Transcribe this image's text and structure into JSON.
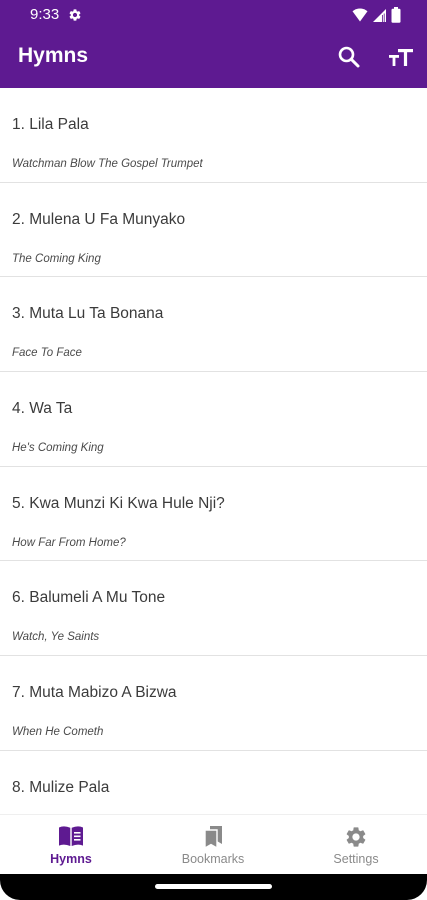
{
  "colors": {
    "primary": "#5e1a91",
    "nav_inactive": "#8a8a8a",
    "divider": "#e2e2e2"
  },
  "status_bar": {
    "time": "9:33",
    "icons": [
      "settings-icon",
      "wifi-icon",
      "signal-icon",
      "battery-icon"
    ]
  },
  "app_bar": {
    "title": "Hymns",
    "actions": [
      "search-icon",
      "text-size-icon"
    ]
  },
  "hymns": [
    {
      "title": "1. Lila Pala",
      "subtitle": "Watchman Blow The Gospel Trumpet"
    },
    {
      "title": "2. Mulena U Fa Munyako",
      "subtitle": "The Coming King"
    },
    {
      "title": "3. Muta Lu Ta Bonana",
      "subtitle": "Face To Face"
    },
    {
      "title": "4. Wa Ta",
      "subtitle": "He's Coming King"
    },
    {
      "title": "5. Kwa Munzi Ki Kwa Hule Nji?",
      "subtitle": "How Far From Home?"
    },
    {
      "title": "6. Balumeli A Mu Tone",
      "subtitle": "Watch, Ye Saints"
    },
    {
      "title": "7. Muta Mabizo A Bizwa",
      "subtitle": "When He Cometh"
    },
    {
      "title": "8. Mulize Pala",
      "subtitle": ""
    }
  ],
  "bottom_nav": {
    "items": [
      {
        "label": "Hymns",
        "icon": "book-open-icon",
        "active": true
      },
      {
        "label": "Bookmarks",
        "icon": "bookmarks-icon",
        "active": false
      },
      {
        "label": "Settings",
        "icon": "gear-icon",
        "active": false
      }
    ]
  }
}
